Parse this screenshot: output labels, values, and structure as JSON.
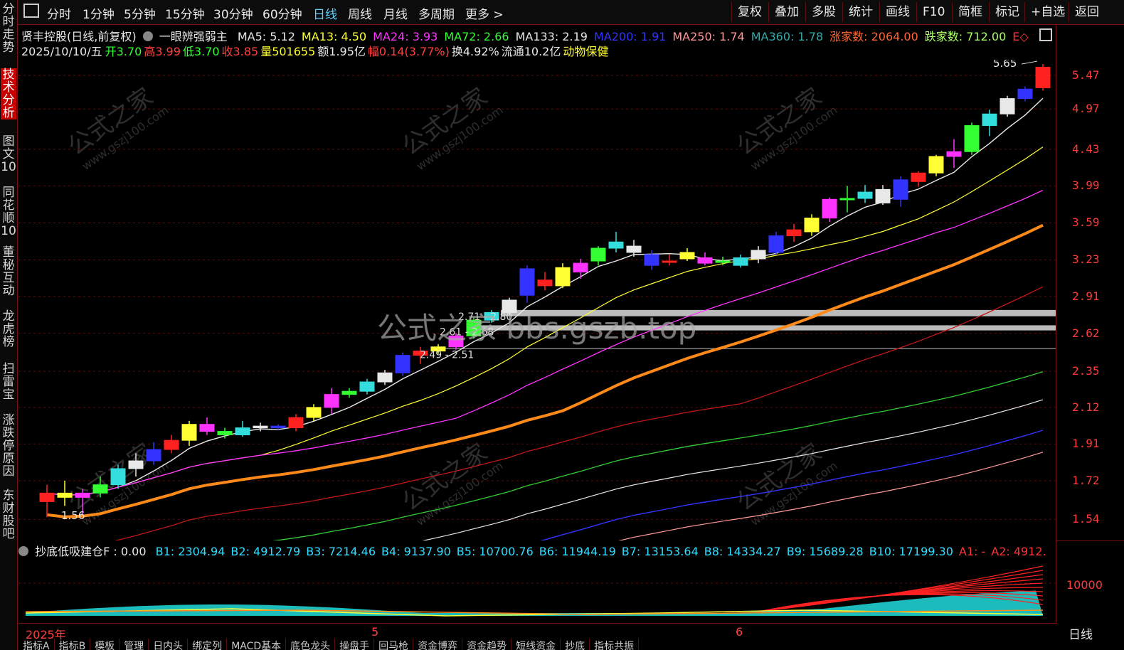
{
  "toolbar": {
    "left_items": [
      "分时",
      "1分钟",
      "5分钟",
      "15分钟",
      "30分钟",
      "60分钟",
      "日线",
      "周线",
      "月线",
      "多周期",
      "更多 >"
    ],
    "active": "日线",
    "right_items": [
      "复权",
      "叠加",
      "多股",
      "统计",
      "画线",
      "F10",
      "简框",
      "标记",
      "+自选",
      "返回"
    ]
  },
  "left_nav": [
    "分时走势",
    "技术分析",
    "图文10",
    "同花顺10",
    "董秘互动",
    "龙虎榜",
    "扫雷宝",
    "涨跌停原因",
    "东财股吧"
  ],
  "left_nav_active": "技术分析",
  "header": {
    "stock": "贤丰控股(日线,前复权)",
    "indicator": "一眼辨强弱主",
    "ma": [
      {
        "label": "MA5: 5.12",
        "color": "#e8e8e8"
      },
      {
        "label": "MA13: 4.50",
        "color": "#ffff33"
      },
      {
        "label": "MA24: 3.93",
        "color": "#ff33ff"
      },
      {
        "label": "MA72: 2.66",
        "color": "#33ff33"
      },
      {
        "label": "MA133: 2.19",
        "color": "#e8e8e8"
      },
      {
        "label": "MA200: 1.91",
        "color": "#3333ff"
      },
      {
        "label": "MA250: 1.74",
        "color": "#ff9999"
      },
      {
        "label": "MA360: 1.78",
        "color": "#33aaaa"
      },
      {
        "label": "涨家数: 2064.00",
        "color": "#ff6633"
      },
      {
        "label": "跌家数: 712.00",
        "color": "#aaff66"
      },
      {
        "label": "E◇",
        "color": "#ff3333"
      }
    ],
    "line2": [
      {
        "label": "2025/10/10/五",
        "color": "#e8e8e8"
      },
      {
        "label": "开3.70",
        "color": "#33ff33"
      },
      {
        "label": "高3.99",
        "color": "#ff4040"
      },
      {
        "label": "低3.70",
        "color": "#33ff33"
      },
      {
        "label": "收3.85",
        "color": "#ff4040"
      },
      {
        "label": "量501655",
        "color": "#ffff33"
      },
      {
        "label": "额1.95亿",
        "color": "#e8e8e8"
      },
      {
        "label": "幅0.14(3.77%)",
        "color": "#ff4040"
      },
      {
        "label": "换4.92%",
        "color": "#e8e8e8"
      },
      {
        "label": "流通10.2亿",
        "color": "#e8e8e8"
      },
      {
        "label": "动物保健",
        "color": "#ffff33"
      }
    ]
  },
  "price_axis": [
    "5.47",
    "4.97",
    "4.43",
    "3.99",
    "3.59",
    "3.23",
    "2.91",
    "2.62",
    "2.35",
    "2.12",
    "1.91",
    "1.72",
    "1.54"
  ],
  "price_marks": {
    "high": "5.65",
    "low": "1.56"
  },
  "zones": [
    "2.71 - 2.80",
    "2.61 - 2.68",
    "2.49 - 2.51"
  ],
  "sub_indicator": {
    "name": "抄底低吸建仓F",
    "value": ": 0.00",
    "items": [
      {
        "label": "B1: 2304.94",
        "color": "#33ddff"
      },
      {
        "label": "B2: 4912.79",
        "color": "#33ddff"
      },
      {
        "label": "B3: 7214.46",
        "color": "#33ddff"
      },
      {
        "label": "B4: 9137.90",
        "color": "#33ddff"
      },
      {
        "label": "B5: 10700.76",
        "color": "#33ddff"
      },
      {
        "label": "B6: 11944.19",
        "color": "#33ddff"
      },
      {
        "label": "B7: 13153.64",
        "color": "#33ddff"
      },
      {
        "label": "B8: 14334.27",
        "color": "#33ddff"
      },
      {
        "label": "B9: 15689.28",
        "color": "#33ddff"
      },
      {
        "label": "B10: 17199.30",
        "color": "#33ddff"
      },
      {
        "label": "A1: -",
        "color": "#ff3333"
      },
      {
        "label": "A2: 4912.",
        "color": "#ff3333"
      }
    ],
    "axis_label": "10000"
  },
  "dates": [
    {
      "label": "2025年",
      "key": "d1"
    },
    {
      "label": "5",
      "key": "d2"
    },
    {
      "label": "6",
      "key": "d3"
    }
  ],
  "period_label": "日线",
  "bottom_tabs": [
    "指标A",
    "指标B",
    "模板",
    "管理",
    "日内头",
    "绑定列",
    "MACD基本",
    "底色龙头",
    "操盘手",
    "回马枪",
    "资金博弈",
    "资金趋势",
    "短线资金",
    "抄底",
    "指标共振"
  ],
  "watermark": {
    "main": "公式之家 bbs.gszb.top",
    "small_cn": "公式之家",
    "small_url": "www.gszj100.com"
  },
  "candles": [
    [
      1.62,
      1.7,
      1.55,
      1.66
    ],
    [
      1.66,
      1.72,
      1.6,
      1.64
    ],
    [
      1.64,
      1.68,
      1.56,
      1.66
    ],
    [
      1.66,
      1.74,
      1.64,
      1.7
    ],
    [
      1.7,
      1.8,
      1.68,
      1.78
    ],
    [
      1.78,
      1.86,
      1.74,
      1.82
    ],
    [
      1.82,
      1.92,
      1.8,
      1.88
    ],
    [
      1.88,
      1.96,
      1.86,
      1.93
    ],
    [
      1.93,
      2.04,
      1.9,
      2.02
    ],
    [
      2.02,
      2.06,
      1.96,
      1.98
    ],
    [
      1.98,
      2.0,
      1.94,
      1.96
    ],
    [
      1.96,
      2.04,
      1.95,
      2.0
    ],
    [
      2.0,
      2.03,
      1.98,
      2.01
    ],
    [
      2.01,
      2.02,
      1.99,
      2.0
    ],
    [
      2.0,
      2.08,
      1.98,
      2.06
    ],
    [
      2.06,
      2.14,
      2.04,
      2.12
    ],
    [
      2.12,
      2.24,
      2.08,
      2.2
    ],
    [
      2.2,
      2.24,
      2.18,
      2.22
    ],
    [
      2.22,
      2.3,
      2.2,
      2.28
    ],
    [
      2.28,
      2.36,
      2.26,
      2.34
    ],
    [
      2.34,
      2.48,
      2.32,
      2.46
    ],
    [
      2.46,
      2.52,
      2.4,
      2.49
    ],
    [
      2.49,
      2.54,
      2.47,
      2.52
    ],
    [
      2.52,
      2.62,
      2.5,
      2.6
    ],
    [
      2.6,
      2.74,
      2.58,
      2.72
    ],
    [
      2.72,
      2.8,
      2.7,
      2.78
    ],
    [
      2.78,
      2.9,
      2.76,
      2.88
    ],
    [
      2.92,
      3.18,
      2.86,
      3.15
    ],
    [
      3.05,
      3.12,
      2.96,
      3.0
    ],
    [
      3.0,
      3.2,
      2.98,
      3.16
    ],
    [
      3.12,
      3.24,
      3.06,
      3.2
    ],
    [
      3.22,
      3.36,
      3.18,
      3.34
    ],
    [
      3.34,
      3.5,
      3.3,
      3.4
    ],
    [
      3.36,
      3.42,
      3.26,
      3.3
    ],
    [
      3.28,
      3.32,
      3.14,
      3.18
    ],
    [
      3.22,
      3.28,
      3.18,
      3.22
    ],
    [
      3.24,
      3.34,
      3.22,
      3.3
    ],
    [
      3.25,
      3.3,
      3.18,
      3.2
    ],
    [
      3.22,
      3.26,
      3.18,
      3.22
    ],
    [
      3.18,
      3.28,
      3.16,
      3.25
    ],
    [
      3.24,
      3.36,
      3.2,
      3.32
    ],
    [
      3.3,
      3.5,
      3.28,
      3.46
    ],
    [
      3.46,
      3.58,
      3.4,
      3.52
    ],
    [
      3.5,
      3.68,
      3.46,
      3.64
    ],
    [
      3.64,
      3.86,
      3.6,
      3.84
    ],
    [
      3.84,
      3.99,
      3.7,
      3.85
    ],
    [
      3.85,
      4.0,
      3.8,
      3.92
    ],
    [
      3.95,
      4.0,
      3.78,
      3.8
    ],
    [
      3.84,
      4.1,
      3.76,
      4.06
    ],
    [
      4.04,
      4.16,
      3.98,
      4.14
    ],
    [
      4.14,
      4.36,
      4.1,
      4.34
    ],
    [
      4.34,
      4.56,
      4.2,
      4.4
    ],
    [
      4.4,
      4.78,
      4.36,
      4.74
    ],
    [
      4.74,
      4.96,
      4.6,
      4.9
    ],
    [
      4.9,
      5.16,
      4.86,
      5.12
    ],
    [
      5.12,
      5.3,
      5.08,
      5.26
    ],
    [
      5.28,
      5.65,
      5.24,
      5.6
    ]
  ]
}
